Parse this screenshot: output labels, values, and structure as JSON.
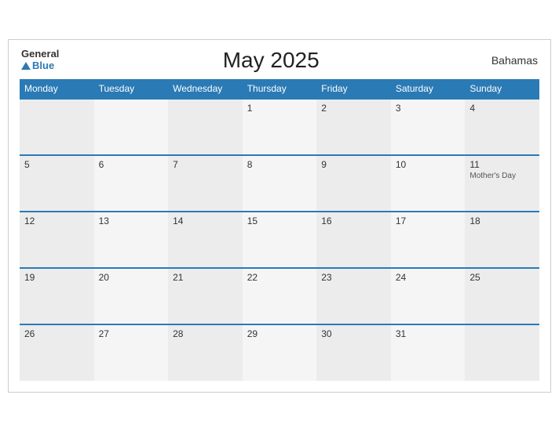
{
  "header": {
    "title": "May 2025",
    "country": "Bahamas",
    "logo_general": "General",
    "logo_blue": "Blue"
  },
  "weekdays": [
    "Monday",
    "Tuesday",
    "Wednesday",
    "Thursday",
    "Friday",
    "Saturday",
    "Sunday"
  ],
  "weeks": [
    [
      {
        "day": "",
        "holiday": ""
      },
      {
        "day": "",
        "holiday": ""
      },
      {
        "day": "",
        "holiday": ""
      },
      {
        "day": "1",
        "holiday": ""
      },
      {
        "day": "2",
        "holiday": ""
      },
      {
        "day": "3",
        "holiday": ""
      },
      {
        "day": "4",
        "holiday": ""
      }
    ],
    [
      {
        "day": "5",
        "holiday": ""
      },
      {
        "day": "6",
        "holiday": ""
      },
      {
        "day": "7",
        "holiday": ""
      },
      {
        "day": "8",
        "holiday": ""
      },
      {
        "day": "9",
        "holiday": ""
      },
      {
        "day": "10",
        "holiday": ""
      },
      {
        "day": "11",
        "holiday": "Mother's Day"
      }
    ],
    [
      {
        "day": "12",
        "holiday": ""
      },
      {
        "day": "13",
        "holiday": ""
      },
      {
        "day": "14",
        "holiday": ""
      },
      {
        "day": "15",
        "holiday": ""
      },
      {
        "day": "16",
        "holiday": ""
      },
      {
        "day": "17",
        "holiday": ""
      },
      {
        "day": "18",
        "holiday": ""
      }
    ],
    [
      {
        "day": "19",
        "holiday": ""
      },
      {
        "day": "20",
        "holiday": ""
      },
      {
        "day": "21",
        "holiday": ""
      },
      {
        "day": "22",
        "holiday": ""
      },
      {
        "day": "23",
        "holiday": ""
      },
      {
        "day": "24",
        "holiday": ""
      },
      {
        "day": "25",
        "holiday": ""
      }
    ],
    [
      {
        "day": "26",
        "holiday": ""
      },
      {
        "day": "27",
        "holiday": ""
      },
      {
        "day": "28",
        "holiday": ""
      },
      {
        "day": "29",
        "holiday": ""
      },
      {
        "day": "30",
        "holiday": ""
      },
      {
        "day": "31",
        "holiday": ""
      },
      {
        "day": "",
        "holiday": ""
      }
    ]
  ]
}
